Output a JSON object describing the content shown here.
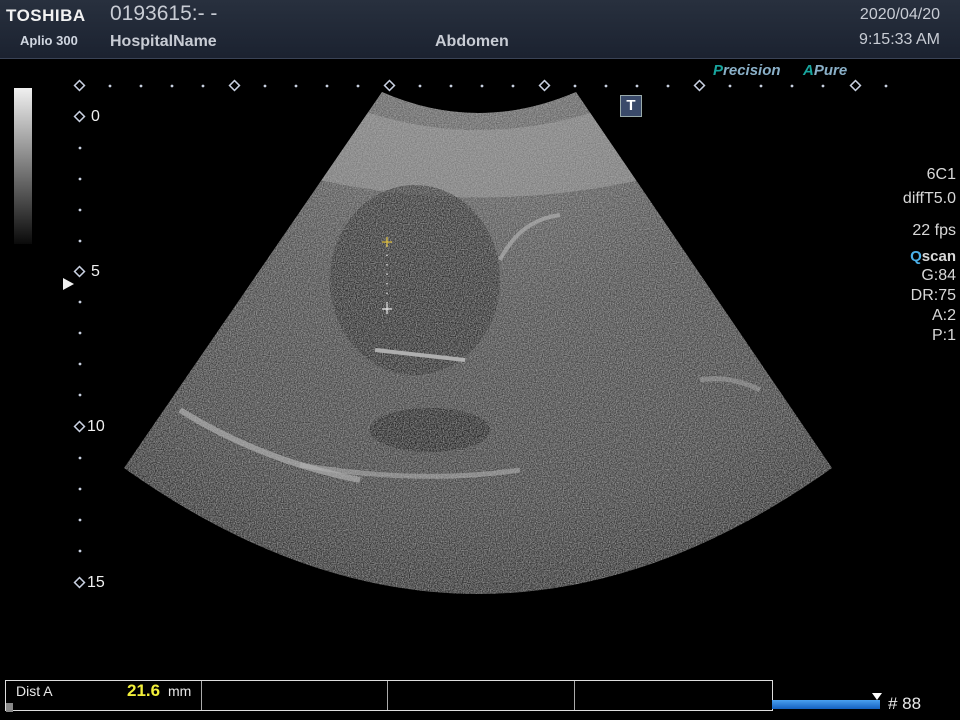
{
  "header": {
    "brand": "TOSHIBA",
    "model": "Aplio 300",
    "patient_id": "0193615:- -",
    "hospital": "HospitalName",
    "exam": "Abdomen",
    "date": "2020/04/20",
    "time": "9:15:33 AM"
  },
  "modes": {
    "precision_initial": "P",
    "precision_rest": "recision",
    "apure_initial": "A",
    "apure_rest": "Pure"
  },
  "t_marker": "T",
  "depth_scale": {
    "labels": [
      "0",
      "5",
      "10",
      "15"
    ],
    "unit": "cm"
  },
  "parameters": {
    "probe": "6C1",
    "preset": "diffT5.0",
    "frame_rate": "22 fps",
    "qscan_q": "Q",
    "qscan_rest": "scan",
    "gain": "G:84",
    "dynamic_range": "DR:75",
    "a": "A:2",
    "p": "P:1"
  },
  "measurement": {
    "label": "Dist A",
    "value": "21.6",
    "unit": "mm"
  },
  "cine": {
    "frame_label": "# 88",
    "progress": 1.0
  },
  "colors": {
    "accent_teal": "#18a59e",
    "measurement_yellow": "#f2ef3a",
    "header_bg": "#1f2736"
  }
}
